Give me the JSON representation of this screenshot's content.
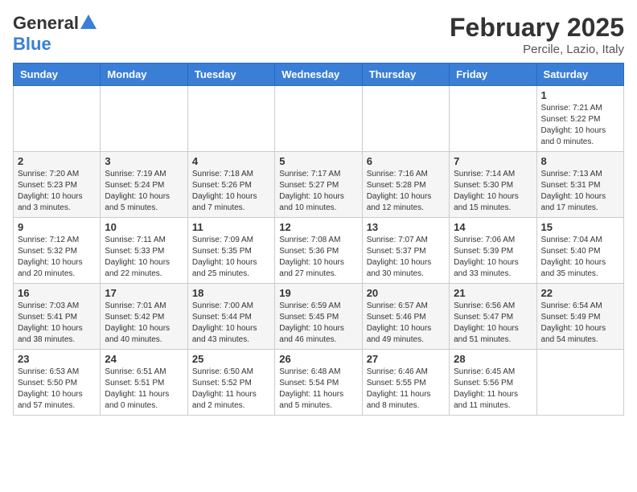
{
  "logo": {
    "general": "General",
    "blue": "Blue"
  },
  "header": {
    "month": "February 2025",
    "location": "Percile, Lazio, Italy"
  },
  "days_of_week": [
    "Sunday",
    "Monday",
    "Tuesday",
    "Wednesday",
    "Thursday",
    "Friday",
    "Saturday"
  ],
  "weeks": [
    [
      {
        "day": "",
        "info": ""
      },
      {
        "day": "",
        "info": ""
      },
      {
        "day": "",
        "info": ""
      },
      {
        "day": "",
        "info": ""
      },
      {
        "day": "",
        "info": ""
      },
      {
        "day": "",
        "info": ""
      },
      {
        "day": "1",
        "info": "Sunrise: 7:21 AM\nSunset: 5:22 PM\nDaylight: 10 hours\nand 0 minutes."
      }
    ],
    [
      {
        "day": "2",
        "info": "Sunrise: 7:20 AM\nSunset: 5:23 PM\nDaylight: 10 hours\nand 3 minutes."
      },
      {
        "day": "3",
        "info": "Sunrise: 7:19 AM\nSunset: 5:24 PM\nDaylight: 10 hours\nand 5 minutes."
      },
      {
        "day": "4",
        "info": "Sunrise: 7:18 AM\nSunset: 5:26 PM\nDaylight: 10 hours\nand 7 minutes."
      },
      {
        "day": "5",
        "info": "Sunrise: 7:17 AM\nSunset: 5:27 PM\nDaylight: 10 hours\nand 10 minutes."
      },
      {
        "day": "6",
        "info": "Sunrise: 7:16 AM\nSunset: 5:28 PM\nDaylight: 10 hours\nand 12 minutes."
      },
      {
        "day": "7",
        "info": "Sunrise: 7:14 AM\nSunset: 5:30 PM\nDaylight: 10 hours\nand 15 minutes."
      },
      {
        "day": "8",
        "info": "Sunrise: 7:13 AM\nSunset: 5:31 PM\nDaylight: 10 hours\nand 17 minutes."
      }
    ],
    [
      {
        "day": "9",
        "info": "Sunrise: 7:12 AM\nSunset: 5:32 PM\nDaylight: 10 hours\nand 20 minutes."
      },
      {
        "day": "10",
        "info": "Sunrise: 7:11 AM\nSunset: 5:33 PM\nDaylight: 10 hours\nand 22 minutes."
      },
      {
        "day": "11",
        "info": "Sunrise: 7:09 AM\nSunset: 5:35 PM\nDaylight: 10 hours\nand 25 minutes."
      },
      {
        "day": "12",
        "info": "Sunrise: 7:08 AM\nSunset: 5:36 PM\nDaylight: 10 hours\nand 27 minutes."
      },
      {
        "day": "13",
        "info": "Sunrise: 7:07 AM\nSunset: 5:37 PM\nDaylight: 10 hours\nand 30 minutes."
      },
      {
        "day": "14",
        "info": "Sunrise: 7:06 AM\nSunset: 5:39 PM\nDaylight: 10 hours\nand 33 minutes."
      },
      {
        "day": "15",
        "info": "Sunrise: 7:04 AM\nSunset: 5:40 PM\nDaylight: 10 hours\nand 35 minutes."
      }
    ],
    [
      {
        "day": "16",
        "info": "Sunrise: 7:03 AM\nSunset: 5:41 PM\nDaylight: 10 hours\nand 38 minutes."
      },
      {
        "day": "17",
        "info": "Sunrise: 7:01 AM\nSunset: 5:42 PM\nDaylight: 10 hours\nand 40 minutes."
      },
      {
        "day": "18",
        "info": "Sunrise: 7:00 AM\nSunset: 5:44 PM\nDaylight: 10 hours\nand 43 minutes."
      },
      {
        "day": "19",
        "info": "Sunrise: 6:59 AM\nSunset: 5:45 PM\nDaylight: 10 hours\nand 46 minutes."
      },
      {
        "day": "20",
        "info": "Sunrise: 6:57 AM\nSunset: 5:46 PM\nDaylight: 10 hours\nand 49 minutes."
      },
      {
        "day": "21",
        "info": "Sunrise: 6:56 AM\nSunset: 5:47 PM\nDaylight: 10 hours\nand 51 minutes."
      },
      {
        "day": "22",
        "info": "Sunrise: 6:54 AM\nSunset: 5:49 PM\nDaylight: 10 hours\nand 54 minutes."
      }
    ],
    [
      {
        "day": "23",
        "info": "Sunrise: 6:53 AM\nSunset: 5:50 PM\nDaylight: 10 hours\nand 57 minutes."
      },
      {
        "day": "24",
        "info": "Sunrise: 6:51 AM\nSunset: 5:51 PM\nDaylight: 11 hours\nand 0 minutes."
      },
      {
        "day": "25",
        "info": "Sunrise: 6:50 AM\nSunset: 5:52 PM\nDaylight: 11 hours\nand 2 minutes."
      },
      {
        "day": "26",
        "info": "Sunrise: 6:48 AM\nSunset: 5:54 PM\nDaylight: 11 hours\nand 5 minutes."
      },
      {
        "day": "27",
        "info": "Sunrise: 6:46 AM\nSunset: 5:55 PM\nDaylight: 11 hours\nand 8 minutes."
      },
      {
        "day": "28",
        "info": "Sunrise: 6:45 AM\nSunset: 5:56 PM\nDaylight: 11 hours\nand 11 minutes."
      },
      {
        "day": "",
        "info": ""
      }
    ]
  ]
}
